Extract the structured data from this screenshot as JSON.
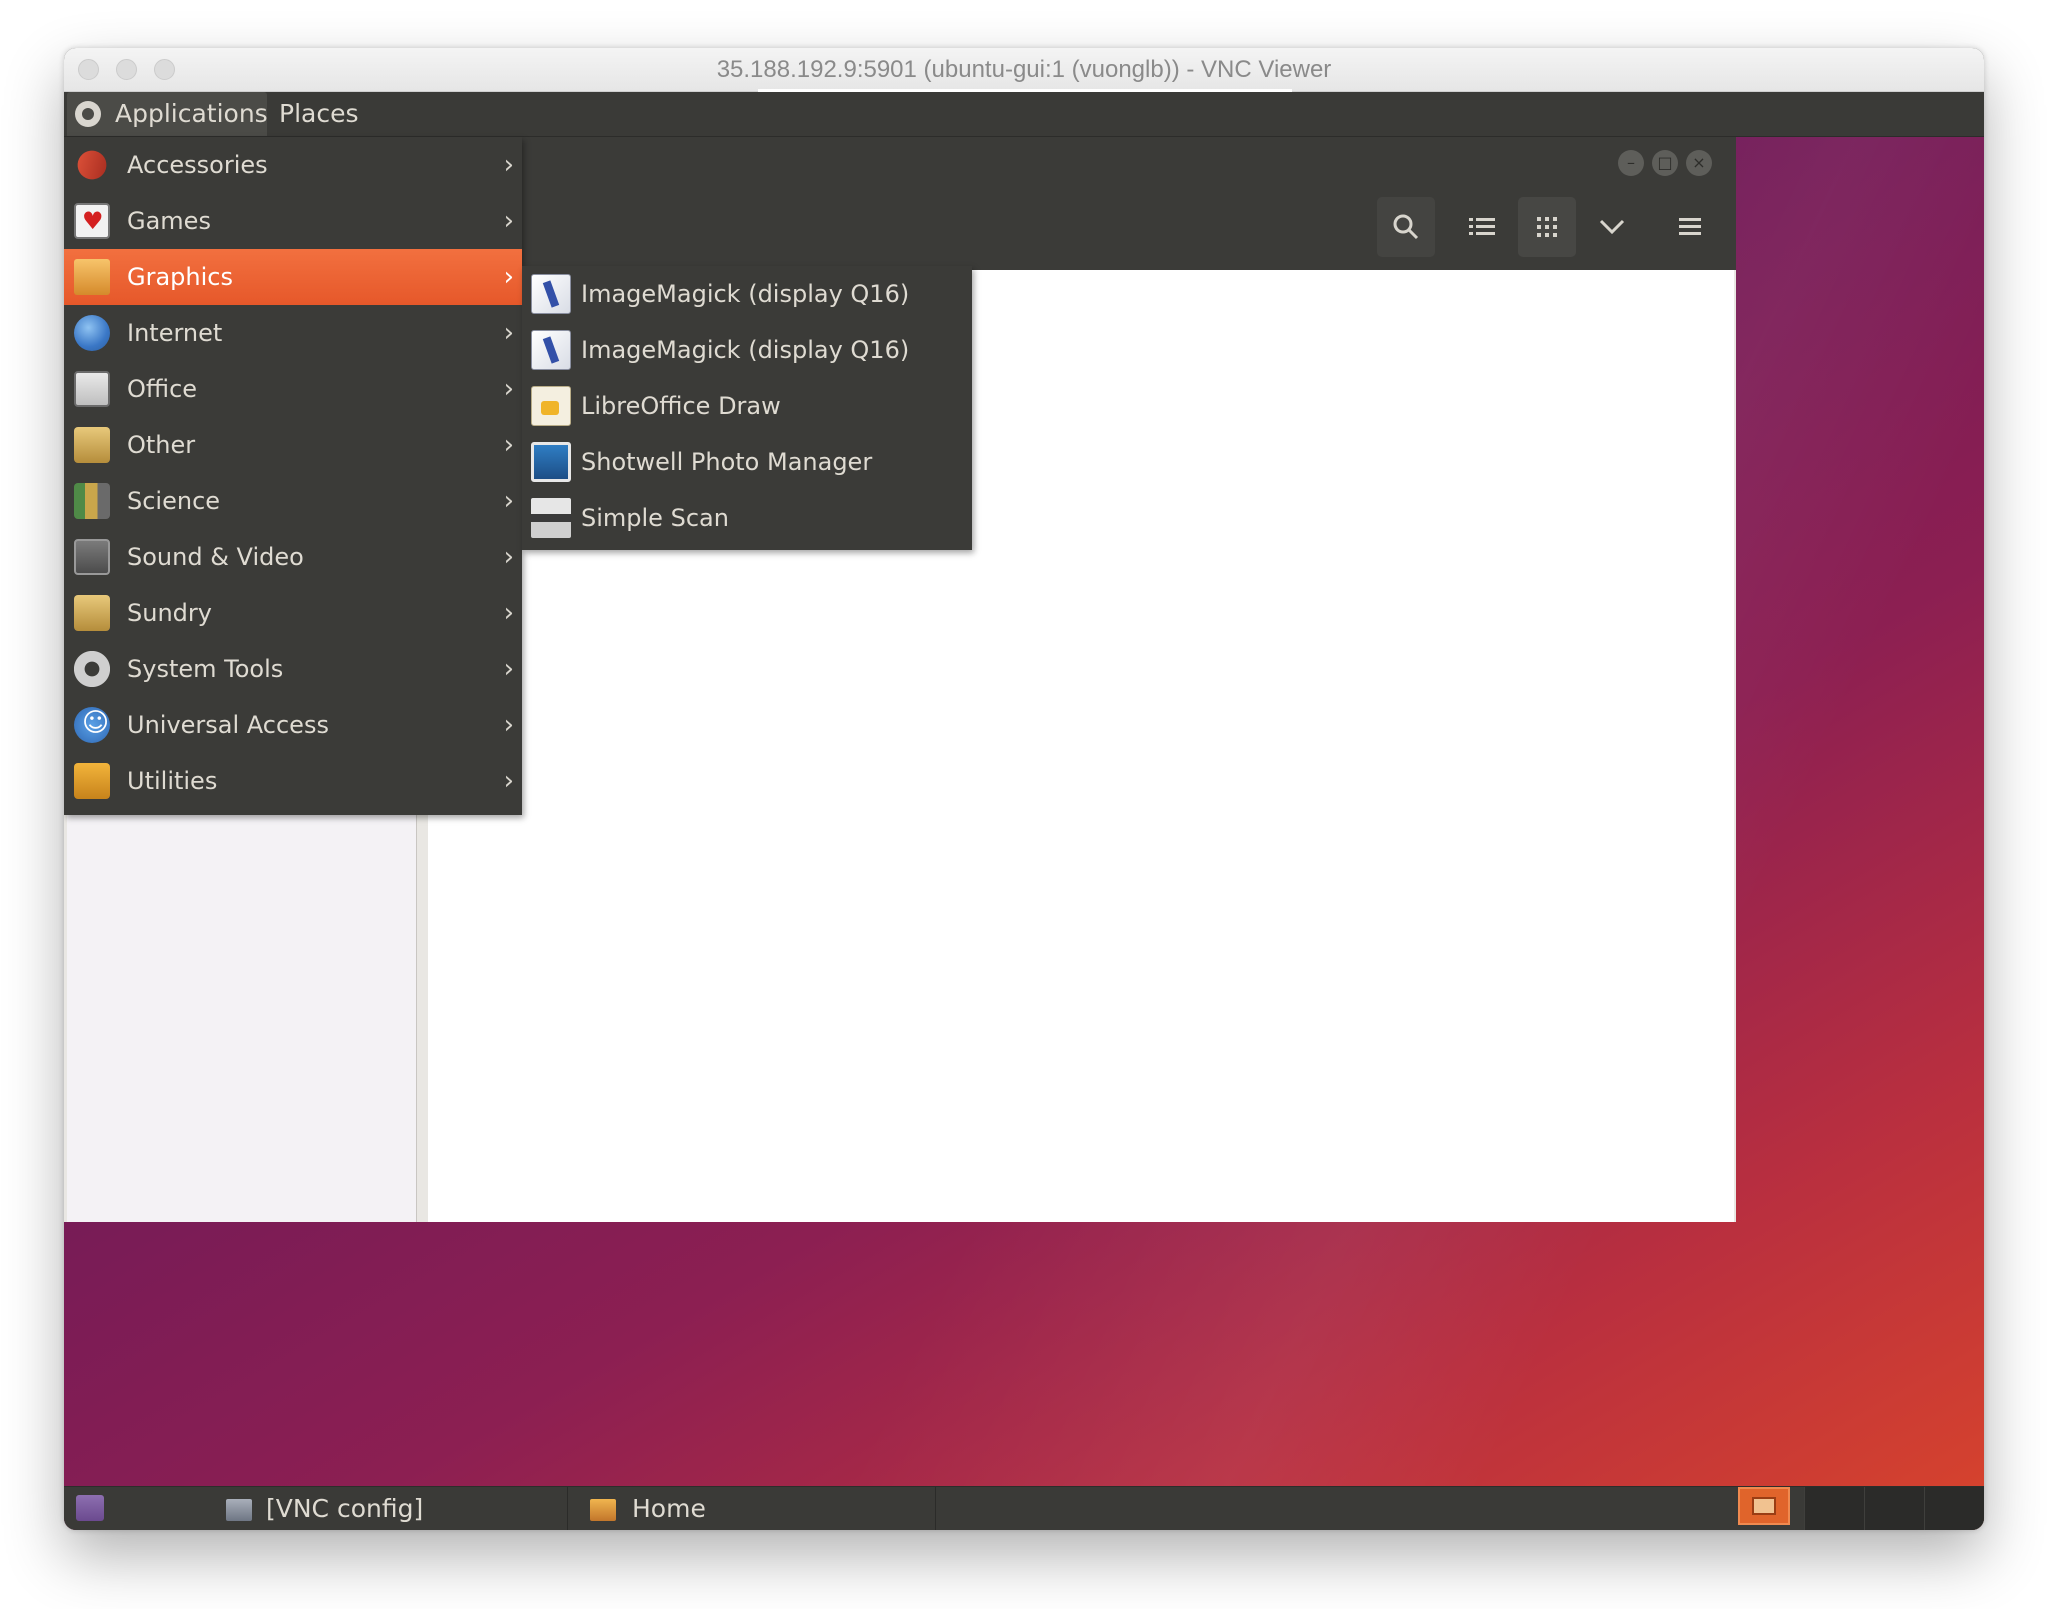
{
  "vnc_window": {
    "title": "35.188.192.9:5901 (ubuntu-gui:1 (vuonglb)) - VNC Viewer"
  },
  "top_panel": {
    "applications_label": "Applications",
    "places_label": "Places"
  },
  "app_menu": {
    "items": [
      {
        "label": "Accessories",
        "icon": "accessories-icon"
      },
      {
        "label": "Games",
        "icon": "games-icon"
      },
      {
        "label": "Graphics",
        "icon": "graphics-icon",
        "active": true
      },
      {
        "label": "Internet",
        "icon": "internet-icon"
      },
      {
        "label": "Office",
        "icon": "office-icon"
      },
      {
        "label": "Other",
        "icon": "other-icon"
      },
      {
        "label": "Science",
        "icon": "science-icon"
      },
      {
        "label": "Sound & Video",
        "icon": "sound-video-icon"
      },
      {
        "label": "Sundry",
        "icon": "sundry-icon"
      },
      {
        "label": "System Tools",
        "icon": "system-tools-icon"
      },
      {
        "label": "Universal Access",
        "icon": "universal-access-icon"
      },
      {
        "label": "Utilities",
        "icon": "utilities-icon"
      }
    ]
  },
  "graphics_submenu": {
    "items": [
      {
        "label": "ImageMagick (display Q16)",
        "icon": "imagemagick-icon"
      },
      {
        "label": "ImageMagick (display Q16)",
        "icon": "imagemagick-icon"
      },
      {
        "label": "LibreOffice Draw",
        "icon": "libreoffice-draw-icon"
      },
      {
        "label": "Shotwell Photo Manager",
        "icon": "shotwell-icon"
      },
      {
        "label": "Simple Scan",
        "icon": "scanner-icon"
      }
    ]
  },
  "file_manager": {
    "toolbar_icons": [
      "search-icon",
      "list-view-icon",
      "grid-view-icon",
      "chevron-down-icon",
      "hamburger-menu-icon"
    ],
    "window_controls": [
      "minimize-icon",
      "maximize-icon",
      "close-icon"
    ]
  },
  "bottom_panel": {
    "tasks": [
      {
        "label": "[VNC config]"
      },
      {
        "label": "Home"
      }
    ]
  },
  "colors": {
    "menu_bg": "#3b3b38",
    "menu_active": "#e6582a",
    "menu_text": "#dfdbd2",
    "desktop_purple": "#701a58",
    "desktop_orange": "#d8442c"
  }
}
